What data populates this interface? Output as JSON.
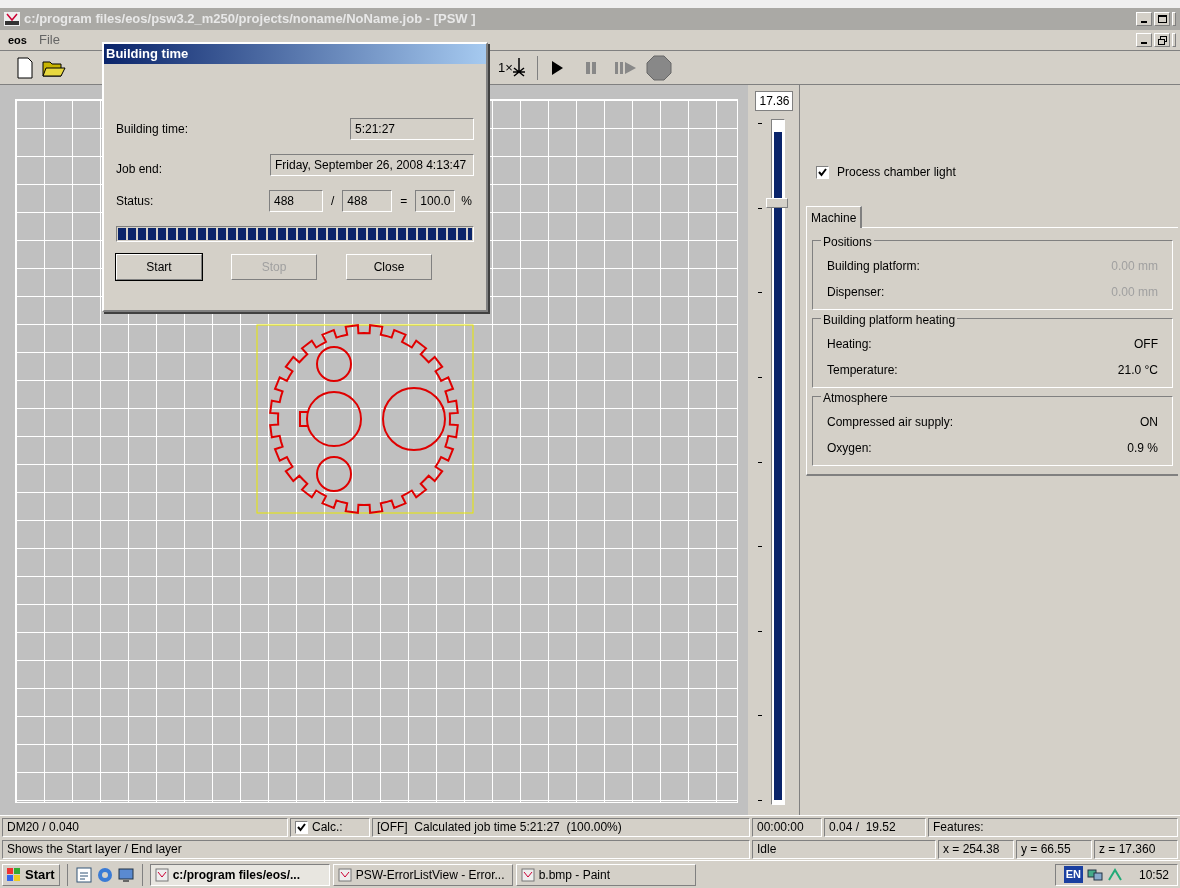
{
  "window": {
    "title": "c:/program files/eos/psw3.2_m250/projects/noname/NoName.job - [PSW ]"
  },
  "menu": [
    "eos",
    "File"
  ],
  "toolbar": {
    "layer_button": "1×"
  },
  "slider": {
    "reading": "17.36",
    "level": 0.87
  },
  "dialog": {
    "title": "Building time",
    "building_time": {
      "label": "Building time:",
      "value": "5:21:27"
    },
    "job_end": {
      "label": "Job end:",
      "value": "Friday, September 26, 2008 4:13:47"
    },
    "status": {
      "label": "Status:",
      "done": "488",
      "slash": "/",
      "total": "488",
      "equals": "=",
      "percent": "100.0",
      "unit": "%"
    },
    "progress": {
      "level": 1.0
    },
    "buttons": [
      {
        "label": "Start",
        "disabled": false,
        "default": true
      },
      {
        "label": "Stop",
        "disabled": true,
        "default": false
      },
      {
        "label": "Close",
        "disabled": false,
        "default": false
      }
    ]
  },
  "panel": {
    "light": {
      "label": "Process chamber light",
      "checked": true
    },
    "tabs": [
      {
        "label": "Machine",
        "selected": true
      }
    ],
    "groups": [
      {
        "title": "Positions",
        "rows": [
          {
            "label": "Building platform:",
            "value": "0.00 mm",
            "disabled": true
          },
          {
            "label": "Dispenser:",
            "value": "0.00 mm",
            "disabled": true
          }
        ]
      },
      {
        "title": "Building platform heating",
        "rows": [
          {
            "label": "Heating:",
            "value": "OFF",
            "disabled": false
          },
          {
            "label": "Temperature:",
            "value": "21.0 °C",
            "disabled": false
          }
        ]
      },
      {
        "title": "Atmosphere",
        "rows": [
          {
            "label": "Compressed air supply:",
            "value": "ON",
            "disabled": false
          },
          {
            "label": "Oxygen:",
            "value": "0.9 %",
            "disabled": false
          }
        ]
      }
    ]
  },
  "status_bar": {
    "material": "DM20 / 0.040",
    "calc": {
      "label": "Calc.:",
      "checked": true
    },
    "job_time": "[OFF]  Calculated job time 5:21:27  (100.00%)",
    "elapsed": "00:00:00",
    "layers": "0.04 /  19.52",
    "features": "Features:",
    "hint": "Shows the Start layer / End layer",
    "state": "Idle",
    "x": "x = 254.38",
    "y": "y = 66.55",
    "z": "z = 17.360"
  },
  "taskbar": {
    "start": "Start",
    "tasks": [
      {
        "label": "c:/program files/eos/...",
        "selected": true
      },
      {
        "label": "PSW-ErrorListView - Error...",
        "selected": false
      },
      {
        "label": "b.bmp - Paint",
        "selected": false
      }
    ],
    "language": "EN",
    "clock": "10:52"
  }
}
